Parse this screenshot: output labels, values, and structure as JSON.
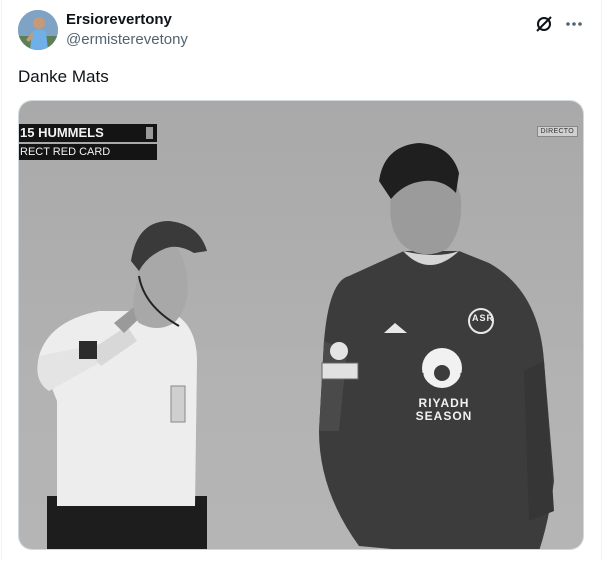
{
  "author": {
    "display_name": "Ersiorevertony",
    "handle": "@ermisterevetony",
    "avatar_icon": "avatar-photo"
  },
  "actions": {
    "grok_icon": "grok-icon",
    "more_icon": "more-icon"
  },
  "tweet": {
    "text": "Danke Mats"
  },
  "media": {
    "chyron_name": "15 HUMMELS",
    "chyron_card": "RECT RED CARD",
    "live_badge": "DIRECTO",
    "shirt_sponsor_line1": "RIYADH",
    "shirt_sponsor_line2": "SEASON",
    "club_crest": "ASR"
  }
}
